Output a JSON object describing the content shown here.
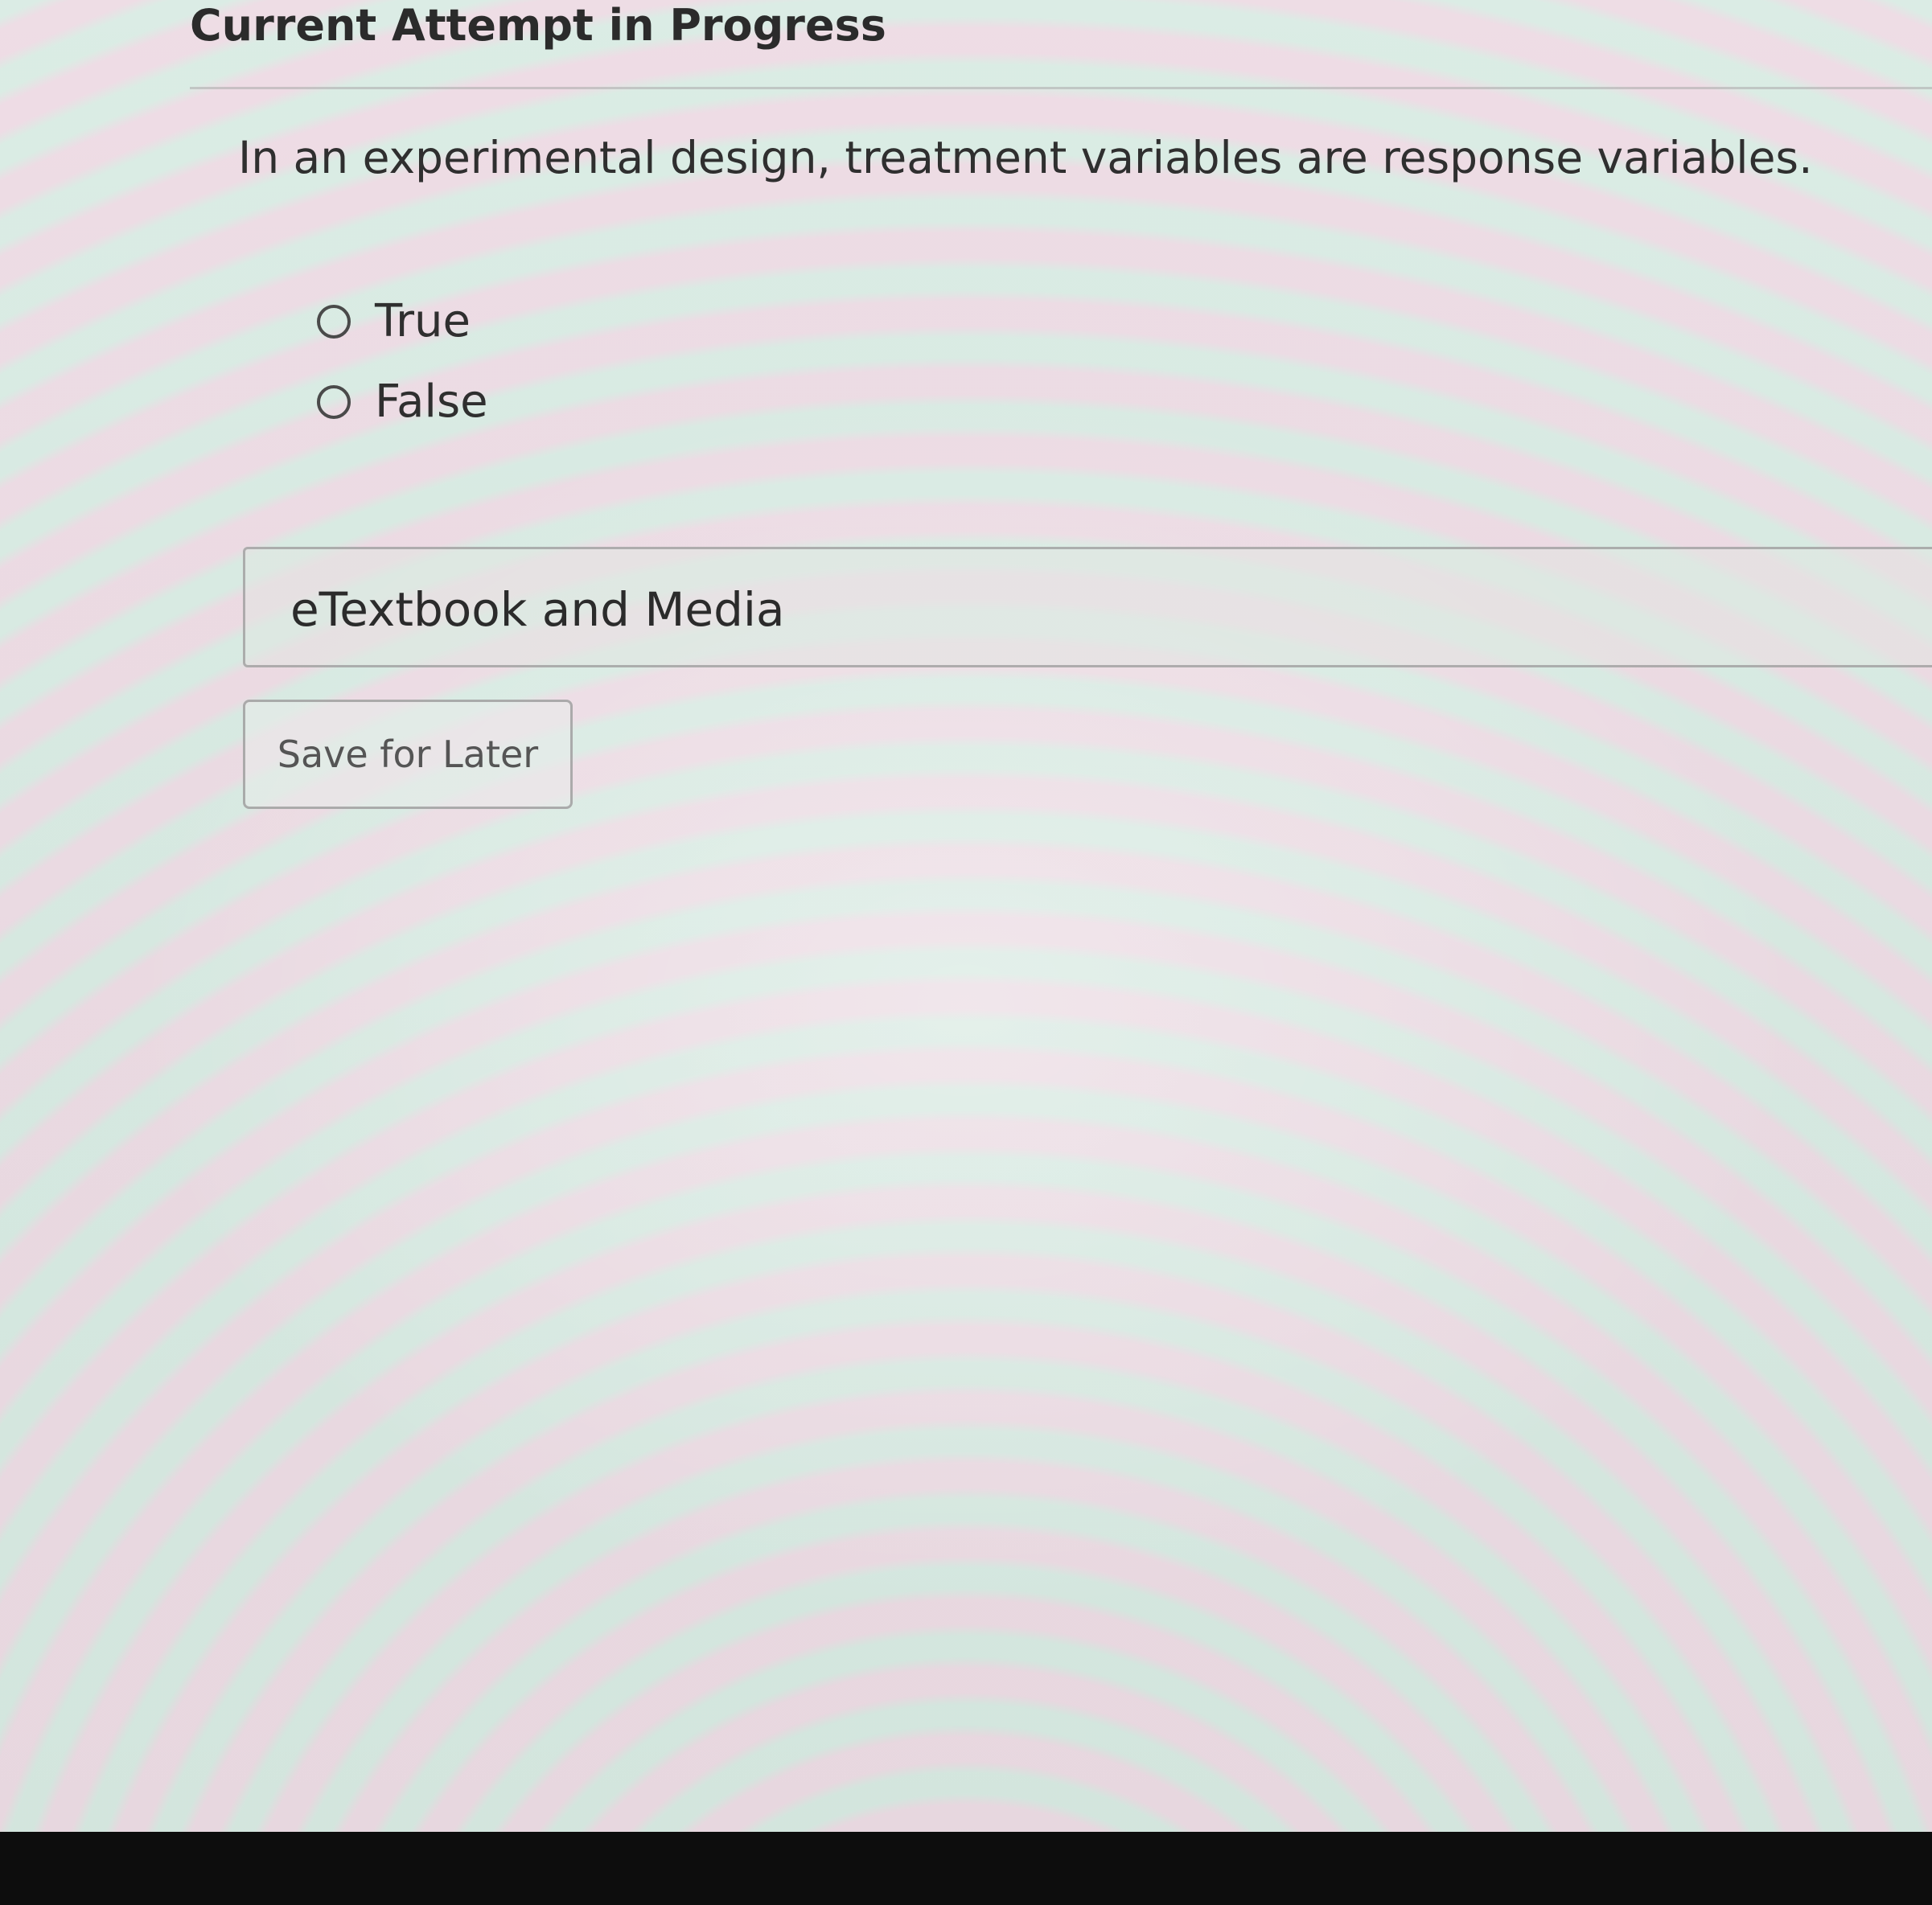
{
  "header": {
    "title": "Current Attempt in Progress"
  },
  "question": {
    "text": "In an experimental design, treatment variables are response variables.",
    "options": [
      {
        "label": "True",
        "selected": false
      },
      {
        "label": "False",
        "selected": false
      }
    ]
  },
  "media_panel": {
    "label": "eTextbook and Media"
  },
  "actions": {
    "save_label": "Save for Later"
  }
}
